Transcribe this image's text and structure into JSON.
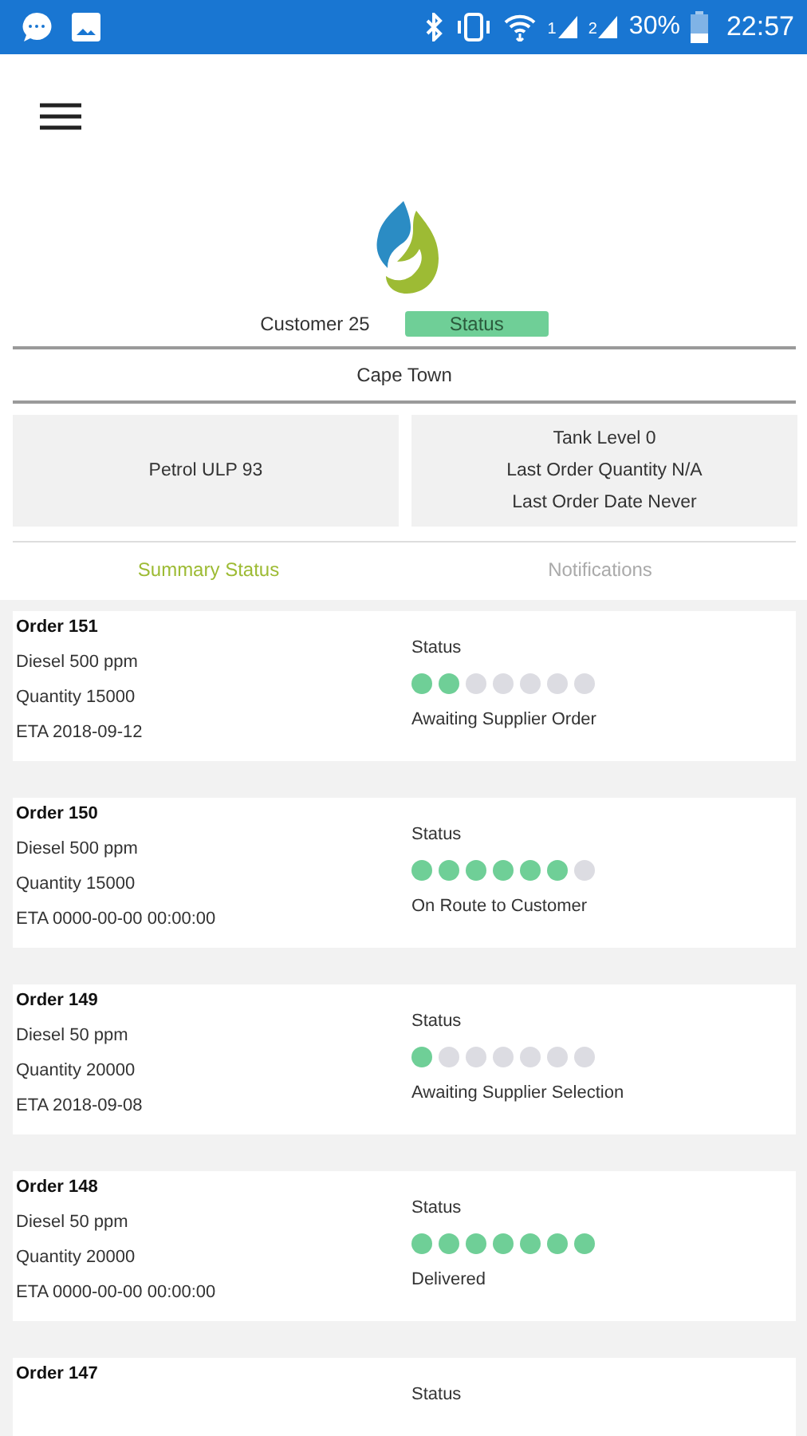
{
  "status_bar": {
    "sims": [
      "1",
      "2"
    ],
    "battery_text": "30%",
    "time": "22:57"
  },
  "customer": {
    "name": "Customer 25",
    "status": "Status",
    "city": "Cape Town"
  },
  "product": "Petrol ULP 93",
  "tank_info": [
    "Tank Level 0",
    "Last Order Quantity N/A",
    "Last Order Date Never"
  ],
  "tabs": [
    {
      "label": "Summary Status",
      "selected": true
    },
    {
      "label": "Notifications",
      "selected": false
    }
  ],
  "orders": [
    {
      "title": "Order 151",
      "lines": [
        "Diesel 500 ppm",
        "Quantity 15000",
        "ETA 2018-09-12"
      ],
      "status_label": "Status",
      "stars": 2,
      "status": "Awaiting Supplier Order"
    },
    {
      "title": "Order 150",
      "lines": [
        "Diesel 500 ppm",
        "Quantity 15000",
        "ETA 0000-00-00 00:00:00"
      ],
      "status_label": "Status",
      "stars": 6,
      "status": "On Route to Customer"
    },
    {
      "title": "Order 149",
      "lines": [
        "Diesel 50 ppm",
        "Quantity 20000",
        "ETA 2018-09-08"
      ],
      "status_label": "Status",
      "stars": 1,
      "status": "Awaiting Supplier Selection"
    },
    {
      "title": "Order 148",
      "lines": [
        "Diesel 50 ppm",
        "Quantity 20000",
        "ETA 0000-00-00 00:00:00"
      ],
      "status_label": "Status",
      "stars": 7,
      "status": "Delivered"
    },
    {
      "title": "Order 147",
      "status_label": "Status"
    }
  ]
}
